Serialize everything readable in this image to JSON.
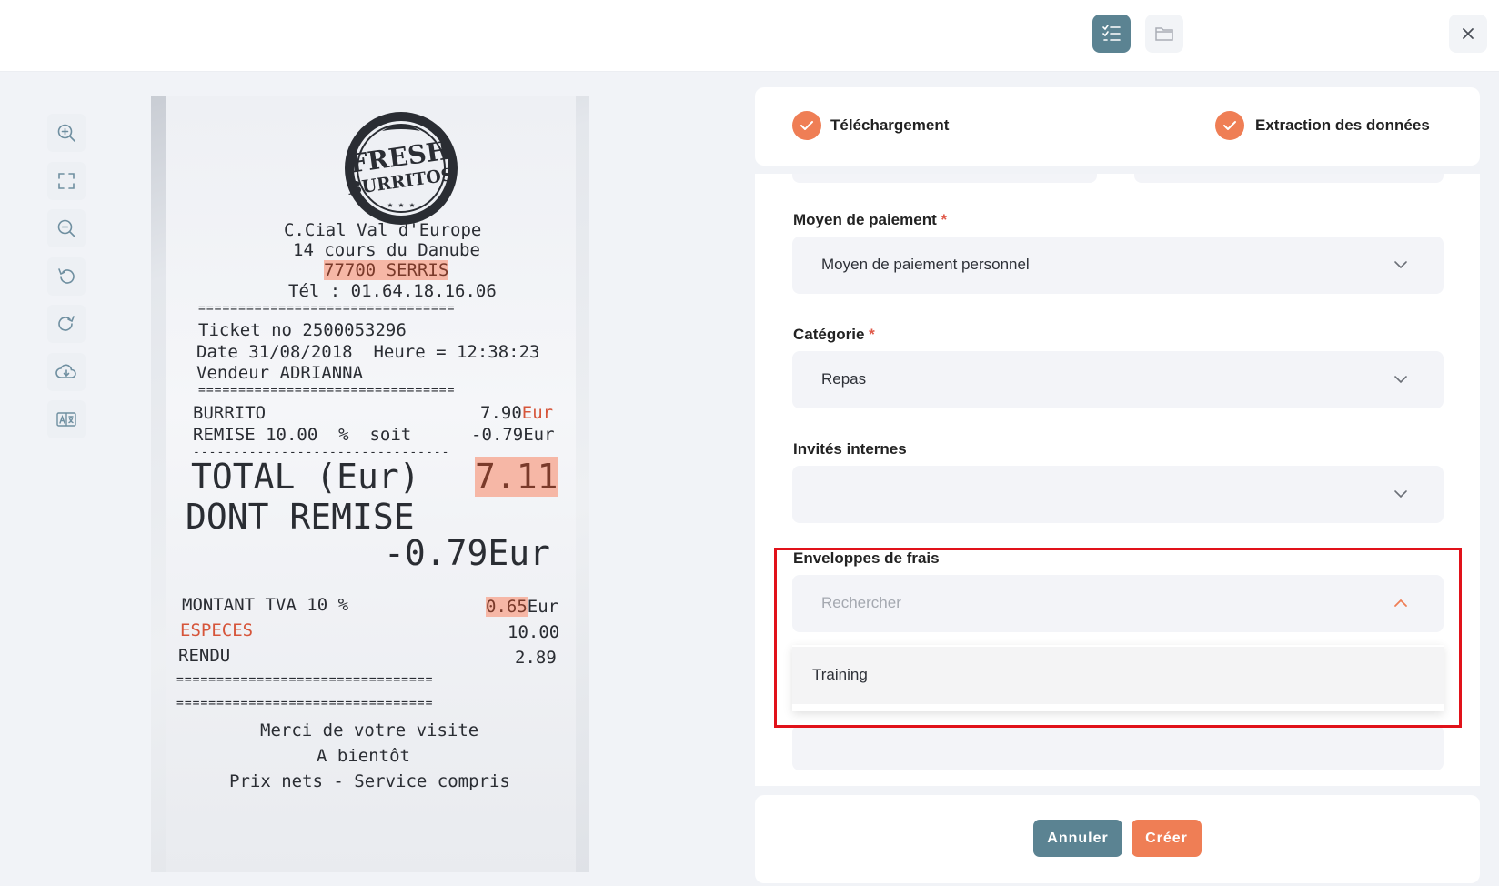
{
  "toolbar": {
    "icons": [
      "checklist-icon",
      "folder-icon",
      "close-icon"
    ],
    "active_color": "#5b8392"
  },
  "viewer_tools": [
    "zoom-in-icon",
    "fit-screen-icon",
    "zoom-out-icon",
    "rotate-left-icon",
    "rotate-right-icon",
    "download-icon",
    "translate-icon"
  ],
  "receipt": {
    "logo_line1": "FRESH",
    "logo_line2": "BURRITOS",
    "addr1": "C.Cial Val d'Europe",
    "addr2": "14 cours du Danube",
    "addr3": "77700 SERRIS",
    "tel": "Tél : 01.64.18.16.06",
    "sep": "================================",
    "ticket": "Ticket no 2500053296",
    "date": "Date 31/08/2018  Heure = 12:38:23",
    "vendeur": "Vendeur ADRIANNA",
    "item1_name": "BURRITO",
    "item1_price": "7.90",
    "item1_unit": "Eur",
    "item2_name": "REMISE 10.00  %  soit",
    "item2_price": "-0.79Eur",
    "dash": "--------------------------------",
    "total_label": "TOTAL (Eur)",
    "total_value": "7.11",
    "remise_label": "DONT REMISE",
    "remise_value": "-0.79Eur",
    "tva_label": "MONTANT TVA 10 %",
    "tva_value": "0.65",
    "tva_unit": "Eur",
    "especes_label": "ESPECES",
    "especes_value": "10.00",
    "rendu_label": "RENDU",
    "rendu_value": "2.89",
    "merci": "Merci de votre visite",
    "bientot": "A bientôt",
    "prix": "Prix nets - Service compris"
  },
  "steps": [
    {
      "label": "Téléchargement",
      "done": true
    },
    {
      "label": "Extraction des données",
      "done": true
    }
  ],
  "form": {
    "payment": {
      "label": "Moyen de paiement",
      "required": "*",
      "value": "Moyen de paiement personnel"
    },
    "category": {
      "label": "Catégorie",
      "required": "*",
      "value": "Repas"
    },
    "guests": {
      "label": "Invités internes",
      "value": ""
    },
    "envelopes": {
      "label": "Enveloppes de frais",
      "placeholder": "Rechercher",
      "options": [
        "Training"
      ]
    }
  },
  "actions": {
    "cancel": "Annuler",
    "create": "Créer"
  },
  "colors": {
    "accent": "#ef7e55",
    "primary": "#5b8392",
    "highlight_box": "#e1121a"
  }
}
